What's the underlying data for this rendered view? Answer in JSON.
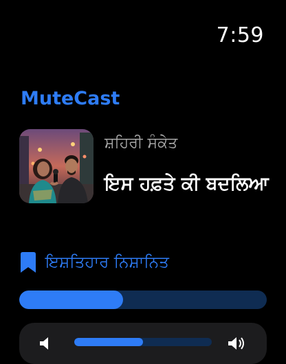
{
  "status_bar": {
    "time": "7:59"
  },
  "app": {
    "name": "MuteCast",
    "accent_color": "#2e7cf6"
  },
  "now_playing": {
    "artwork_icon": "podcast-artwork",
    "show_name": "ਸ਼ਹਿਰੀ ਸੰਕੇਤ",
    "episode_title": "ਇਸ ਹਫ਼ਤੇ ਕੀ ਬਦਲਿਆ",
    "progress_fraction": 0.42
  },
  "actions": {
    "bookmark_icon": "bookmark-icon",
    "bookmark_label": "ਇਸ਼ਤਿਹਾਰ ਨਿਸ਼ਾਨਿਤ"
  },
  "volume": {
    "level_fraction": 0.5,
    "down_icon": "speaker-icon",
    "up_icon": "speaker-loud-icon"
  }
}
